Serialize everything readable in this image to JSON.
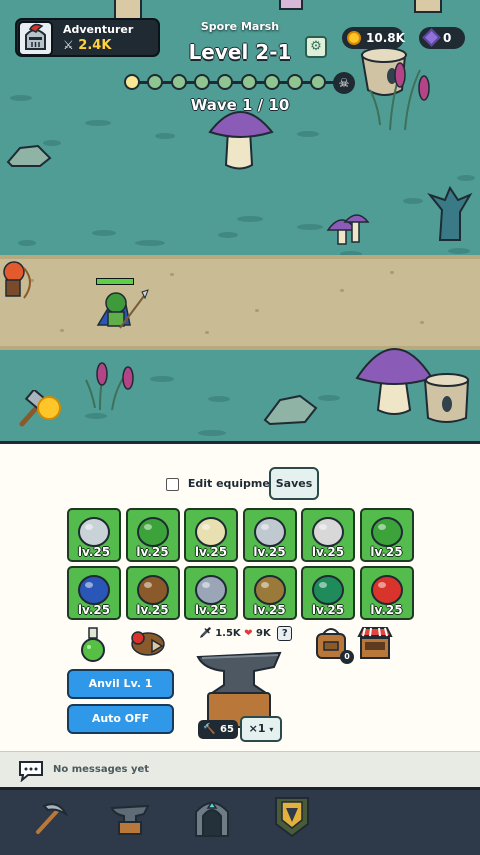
{
  "player": {
    "name": "Adventurer",
    "power": "2.4K"
  },
  "zone": {
    "name": "Spore Marsh",
    "level": "Level 2-1"
  },
  "currency": {
    "gold": "10.8K",
    "gems": "0"
  },
  "wave": {
    "label": "Wave 1 / 10",
    "current": 1,
    "total": 10
  },
  "hero": {
    "hp_fraction": 1.0
  },
  "panel": {
    "edit_equipment_label": "Edit equipment",
    "edit_equipment_checked": false,
    "saves_label": "Saves",
    "equipment": [
      {
        "slot": "spear",
        "level": "lv.25"
      },
      {
        "slot": "hood",
        "level": "lv.25"
      },
      {
        "slot": "helmet",
        "level": "lv.25"
      },
      {
        "slot": "chestplate",
        "level": "lv.25"
      },
      {
        "slot": "gauntlets",
        "level": "lv.25"
      },
      {
        "slot": "pants",
        "level": "lv.25"
      },
      {
        "slot": "cape",
        "level": "lv.25"
      },
      {
        "slot": "boots",
        "level": "lv.25"
      },
      {
        "slot": "belt",
        "level": "lv.25"
      },
      {
        "slot": "necklace",
        "level": "lv.25"
      },
      {
        "slot": "ring-emerald",
        "level": "lv.25"
      },
      {
        "slot": "ring-ruby",
        "level": "lv.25"
      }
    ],
    "stats": {
      "attack": "1.5K",
      "health": "9K",
      "help": "?"
    },
    "anvil_button": "Anvil Lv. 1",
    "auto_button": "Auto OFF",
    "hammers": "65",
    "multiplier": "×1",
    "bag_count": "0"
  },
  "chat": {
    "empty_text": "No messages yet"
  },
  "colors": {
    "slot_bg": "#54bb4d",
    "blue_button": "#2f98e8",
    "scene_bg": "#4f9d94",
    "gold": "#ffd23f"
  },
  "nav": [
    "pickaxe-icon",
    "anvil-icon",
    "dungeon-gate-icon",
    "guild-banner-icon"
  ]
}
